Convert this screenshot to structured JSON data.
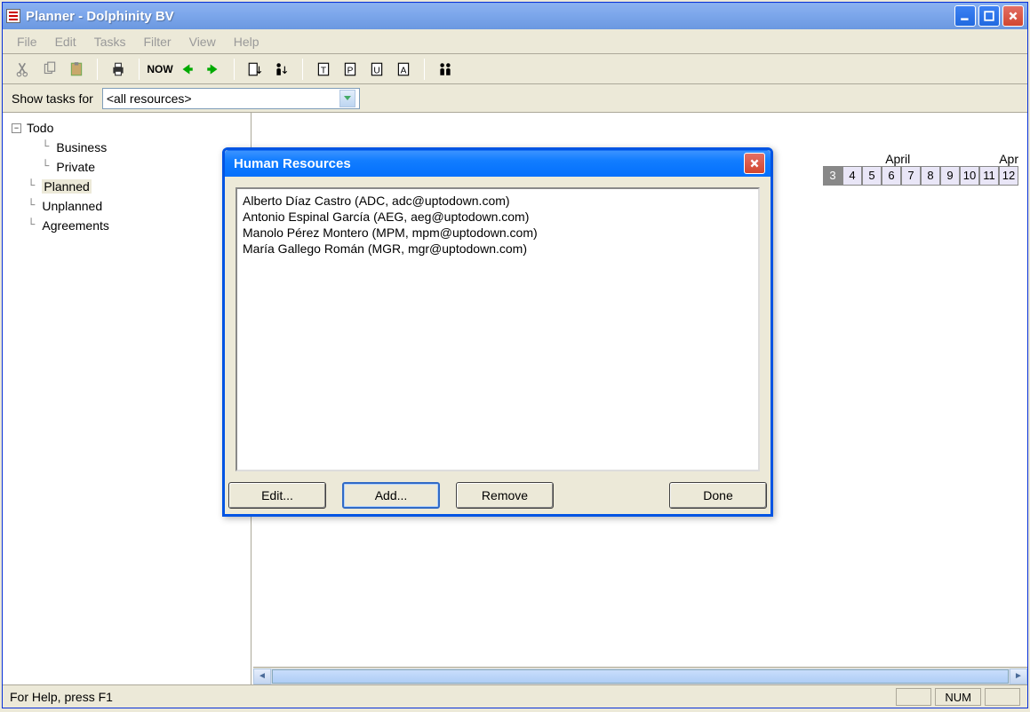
{
  "titlebar": {
    "text": "Planner  -  Dolphinity BV"
  },
  "menu": {
    "file": "File",
    "edit": "Edit",
    "tasks": "Tasks",
    "filter": "Filter",
    "view": "View",
    "help": "Help"
  },
  "toolbar": {
    "now": "NOW"
  },
  "filter": {
    "label": "Show tasks for",
    "combo": "<all resources>"
  },
  "tree": {
    "root": "Todo",
    "business": "Business",
    "private": "Private",
    "planned": "Planned",
    "unplanned": "Unplanned",
    "agreements": "Agreements"
  },
  "calendar": {
    "month1": "April",
    "month2": "Apr",
    "days": [
      "3",
      "4",
      "5",
      "6",
      "7",
      "8",
      "9",
      "10",
      "11",
      "12"
    ]
  },
  "dialog": {
    "title": "Human Resources",
    "items": [
      "Alberto Díaz Castro (ADC, adc@uptodown.com)",
      "Antonio Espinal García (AEG, aeg@uptodown.com)",
      "Manolo Pérez Montero (MPM, mpm@uptodown.com)",
      "María Gallego Román (MGR, mgr@uptodown.com)"
    ],
    "edit": "Edit...",
    "add": "Add...",
    "remove": "Remove",
    "done": "Done"
  },
  "status": {
    "help": "For Help, press F1",
    "num": "NUM"
  }
}
